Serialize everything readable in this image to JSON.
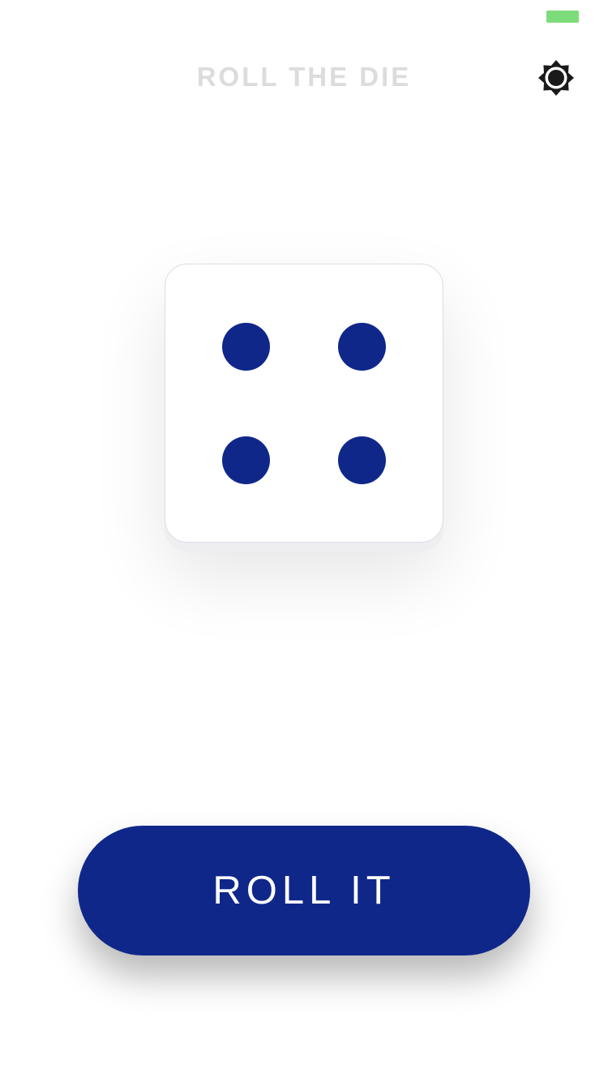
{
  "status_bar": {
    "battery_color": "#7ddc7a"
  },
  "header": {
    "title": "ROLL THE DIE",
    "title_color": "#dcdcdc",
    "theme_icon": "brightness-icon",
    "theme_icon_color": "#1a1a1a"
  },
  "die": {
    "face_value": 4,
    "pip_color": "#10278a"
  },
  "actions": {
    "roll_label": "ROLL IT",
    "roll_color": "#10278a"
  }
}
